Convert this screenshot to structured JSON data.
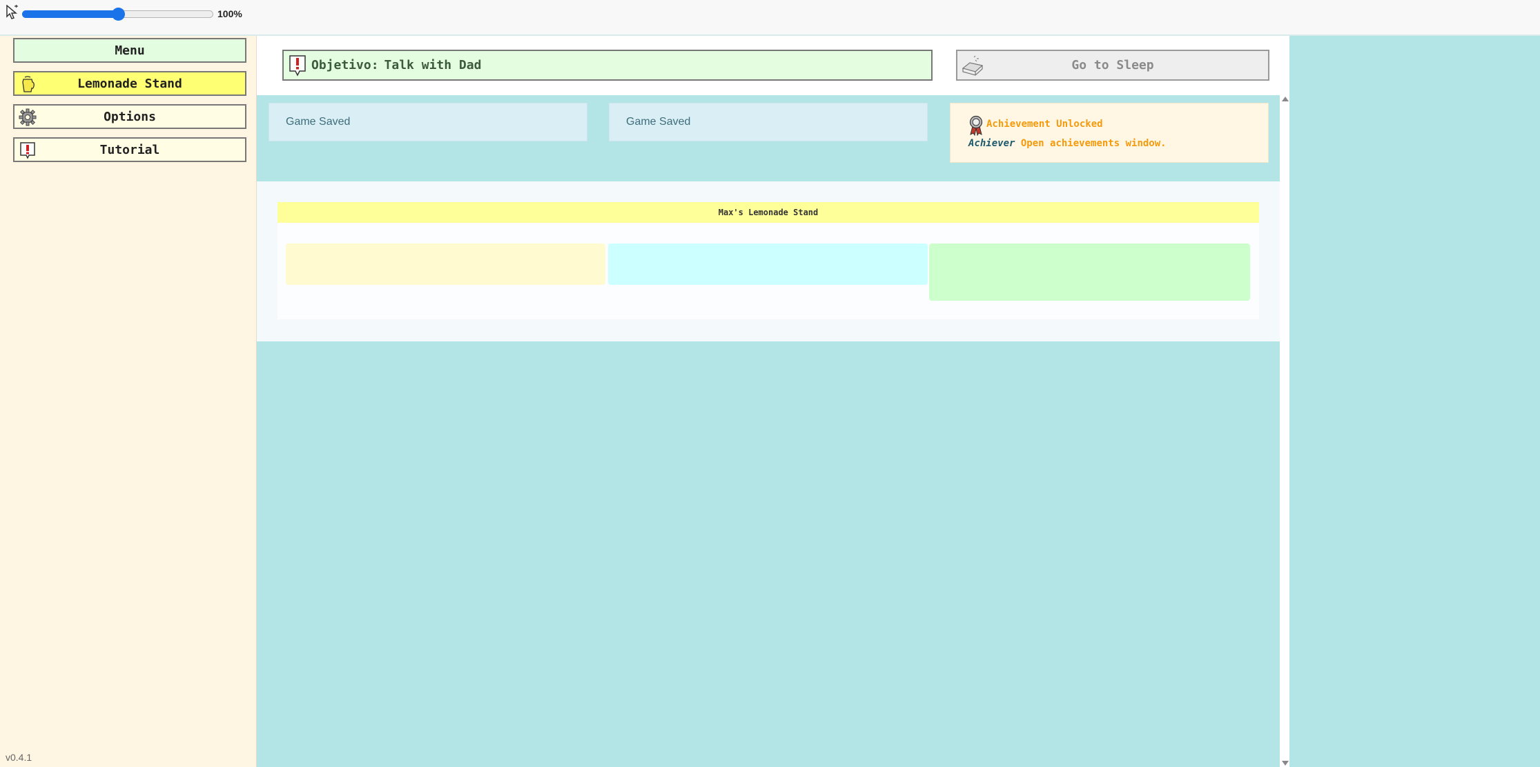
{
  "zoom": {
    "value_label": "100%",
    "level_fraction": 0.5
  },
  "sidebar": {
    "menu_label": "Menu",
    "items": [
      {
        "label": "Lemonade Stand",
        "icon": "lemonade-jug-icon"
      },
      {
        "label": "Options",
        "icon": "gear-icon"
      },
      {
        "label": "Tutorial",
        "icon": "exclamation-icon"
      }
    ],
    "version": "v0.4.1"
  },
  "header": {
    "objective_label": "Objetivo:",
    "objective_text": "Talk with Dad",
    "sleep_label": "Go to Sleep"
  },
  "notifications": [
    {
      "text": "Game Saved"
    },
    {
      "text": "Game Saved"
    }
  ],
  "achievement": {
    "title": "Achievement Unlocked",
    "name": "Achiever",
    "description": "Open achievements window."
  },
  "stand": {
    "title": "Max's Lemonade Stand"
  },
  "colors": {
    "background": "#b3e5e6",
    "sidebar": "#fff5e3",
    "menu_button": "#e2fde0",
    "active_button": "#ffff73",
    "achievement_text": "#f49a0c",
    "slider": "#1a73e8"
  }
}
